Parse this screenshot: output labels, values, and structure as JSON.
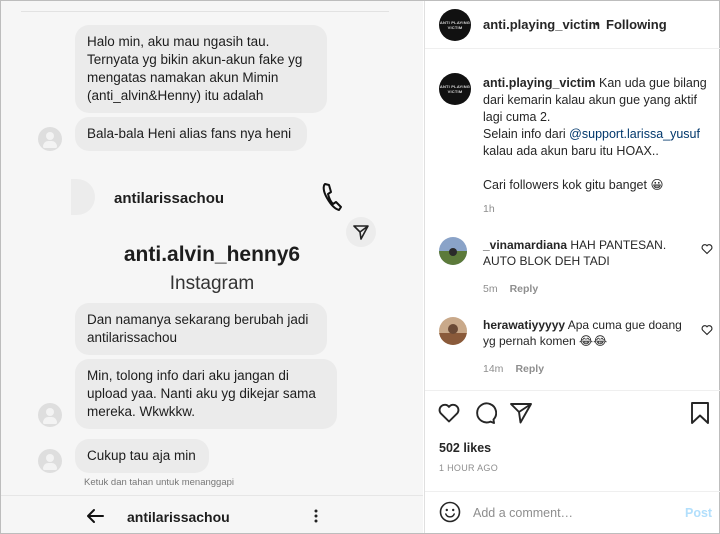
{
  "left_panel": {
    "messages": [
      {
        "text": "Halo min, aku mau ngasih tau.\nTernyata yg bikin akun-akun fake yg\nmengatas namakan akun Mimin\n(anti_alvin&Henny) itu adalah"
      },
      {
        "text": "Bala-bala Heni alias fans nya heni"
      },
      {
        "text": "Dan namanya sekarang berubah jadi\nantilarissachou"
      },
      {
        "text": "Min, tolong info dari aku jangan di\nupload yaa. Nanti aku yg dikejar sama\nmereka. Wkwkkw."
      },
      {
        "text": "Cukup tau aja min"
      }
    ],
    "dm_header_name": "antilarissachou",
    "profile_name": "anti.alvin_henny6",
    "profile_subtitle": "Instagram",
    "hint": "Ketuk dan tahan untuk menanggapi",
    "bottom_name": "antilarissachou"
  },
  "post": {
    "avatar_logo": "ANTI PLAYING VICTIM",
    "username": "anti.playing_victim",
    "dot": "•",
    "follow_status": "Following",
    "caption_user": "anti.playing_victim",
    "caption_line1": "Kan uda gue bilang dari kemarin kalau akun gue yang aktif lagi cuma 2.",
    "caption_line2a": "Selain info dari ",
    "caption_mention": "@support.larissa_yusuf",
    "caption_line2b": " kalau ada akun baru itu HOAX..",
    "caption_line3": "Cari followers kok gitu banget 😀",
    "caption_time": "1h",
    "comments": [
      {
        "user": "_vinamardiana",
        "text": "HAH PANTESAN. AUTO BLOK DEH TADI",
        "time": "5m",
        "reply": "Reply"
      },
      {
        "user": "herawatiyyyyy",
        "text": "Apa cuma gue doang yg pernah komen 😂😂",
        "time": "14m",
        "reply": "Reply"
      }
    ],
    "likes": "502 likes",
    "posted": "1 HOUR AGO",
    "comment_placeholder": "Add a comment…",
    "post_button": "Post"
  }
}
